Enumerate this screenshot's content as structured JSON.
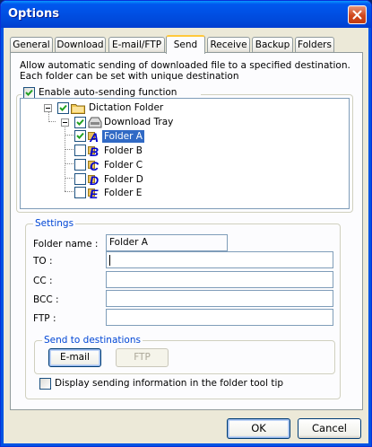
{
  "window": {
    "title": "Options"
  },
  "tabs": [
    {
      "label": "General"
    },
    {
      "label": "Download"
    },
    {
      "label": "E-mail/FTP"
    },
    {
      "label": "Send"
    },
    {
      "label": "Receive"
    },
    {
      "label": "Backup"
    },
    {
      "label": "Folders"
    }
  ],
  "active_tab": "Send",
  "description": "Allow automatic sending of downloaded file to a specified destination. Each folder can be set with unique destination",
  "enable_auto_sending": {
    "label": "Enable auto-sending function",
    "checked": true
  },
  "tree": {
    "root": {
      "label": "Dictation Folder",
      "checked": true
    },
    "tray": {
      "label": "Download Tray",
      "checked": true
    },
    "folders": [
      {
        "letter": "A",
        "label": "Folder A",
        "checked": true,
        "selected": true
      },
      {
        "letter": "B",
        "label": "Folder B",
        "checked": false
      },
      {
        "letter": "C",
        "label": "Folder C",
        "checked": false
      },
      {
        "letter": "D",
        "label": "Folder D",
        "checked": false
      },
      {
        "letter": "E",
        "label": "Folder E",
        "checked": false
      }
    ]
  },
  "settings": {
    "title": "Settings",
    "folder_name_label": "Folder name :",
    "folder_name_value": "Folder A",
    "to_label": "TO :",
    "to_value": "",
    "cc_label": "CC :",
    "cc_value": "",
    "bcc_label": "BCC :",
    "bcc_value": "",
    "ftp_label": "FTP :",
    "ftp_value": ""
  },
  "send_to": {
    "title": "Send to destinations",
    "email_label": "E-mail",
    "ftp_label": "FTP"
  },
  "tooltip_option": {
    "label": "Display sending information in the folder tool tip",
    "checked": false
  },
  "footer": {
    "ok_label": "OK",
    "cancel_label": "Cancel"
  },
  "colors": {
    "title_bar": "#0054e3",
    "group_title": "#0046d5",
    "selection": "#316ac5"
  }
}
